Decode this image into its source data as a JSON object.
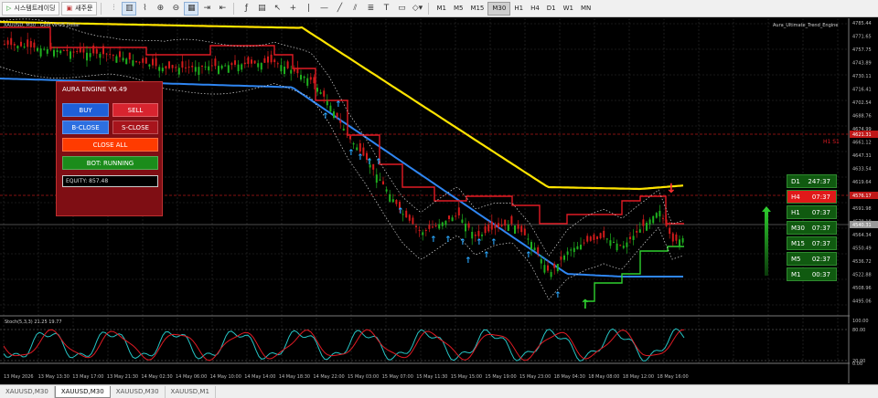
{
  "toolbar": {
    "auto_trading_label": "시스템트레이딩",
    "new_order_label": "새주문",
    "tools": [
      "cursor-icon",
      "crosshair-icon",
      "vertical-line-icon",
      "horizontal-line-icon",
      "trendline-icon",
      "channel-icon",
      "fibonacci-icon",
      "text-icon",
      "label-icon",
      "shapes-icon"
    ],
    "timeframes": [
      "M1",
      "M5",
      "M15",
      "M30",
      "H1",
      "H4",
      "D1",
      "W1",
      "MN"
    ],
    "active_timeframe": "M30"
  },
  "chart": {
    "symbol_info": "XAUUSD, M30 · Gold vs US Dollar",
    "indicator_name": "Aura_Ultimate_Trend_Engine",
    "stoch_label": "Stoch(5,3,3) 21.25  19.77",
    "price_labels": [
      "4785.44",
      "4771.65",
      "4757.75",
      "4743.89",
      "4730.11",
      "4716.41",
      "4702.54",
      "4688.76",
      "4674.99",
      "4661.12",
      "4647.31",
      "4633.54",
      "4619.64",
      "4605.81",
      "4591.98",
      "4578.18",
      "4564.34",
      "4550.49",
      "4536.72",
      "4522.88",
      "4508.96",
      "4495.06"
    ],
    "badge_red_1": "4621.31",
    "badge_red_2": "4576.17",
    "badge_current": "4540.31",
    "hline_label": "H1 S1",
    "stoch_levels": [
      "100.00",
      "80.00",
      "20.00",
      "0.00"
    ],
    "time_labels": [
      "13 May 2026",
      "13 May 13:30",
      "13 May 17:00",
      "13 May 21:30",
      "14 May 02:30",
      "14 May 06:00",
      "14 May 10:00",
      "14 May 14:00",
      "14 May 18:30",
      "14 May 22:00",
      "15 May 03:00",
      "15 May 07:00",
      "15 May 11:30",
      "15 May 15:00",
      "15 May 19:00",
      "15 May 23:00",
      "18 May 04:30",
      "18 May 08:00",
      "18 May 12:00",
      "18 May 16:00"
    ]
  },
  "panel": {
    "title": "AURA ENGINE V6.49",
    "buy": "BUY",
    "sell": "SELL",
    "bclose": "B-CLOSE",
    "sclose": "S-CLOSE",
    "close_all": "CLOSE ALL",
    "bot": "BOT: RUNNING",
    "equity": "EQUITY: 857.48"
  },
  "tf_panel": [
    {
      "tf": "D1",
      "time": "247:37",
      "state": "bull"
    },
    {
      "tf": "H4",
      "time": "07:37",
      "state": "bear"
    },
    {
      "tf": "H1",
      "time": "07:37",
      "state": "bull"
    },
    {
      "tf": "M30",
      "time": "07:37",
      "state": "bull"
    },
    {
      "tf": "M15",
      "time": "07:37",
      "state": "bull"
    },
    {
      "tf": "M5",
      "time": "02:37",
      "state": "bull"
    },
    {
      "tf": "M1",
      "time": "00:37",
      "state": "bull"
    }
  ],
  "bottom_tabs": [
    "XAUUSD,M30",
    "XAUUSD,M30",
    "XAUUSD,M30",
    "XAUUSD,M1"
  ],
  "active_tab": 1,
  "colors": {
    "bull": "#1b8a1b",
    "bear": "#e01919",
    "trend_line": "#ffe400",
    "blue_line": "#2f86f2",
    "red_line": "#e01b24",
    "buy_btn": "#1f5fd8",
    "sell_btn": "#d8242f",
    "close_all": "#ff3b00",
    "bot": "#1b8c1b"
  }
}
